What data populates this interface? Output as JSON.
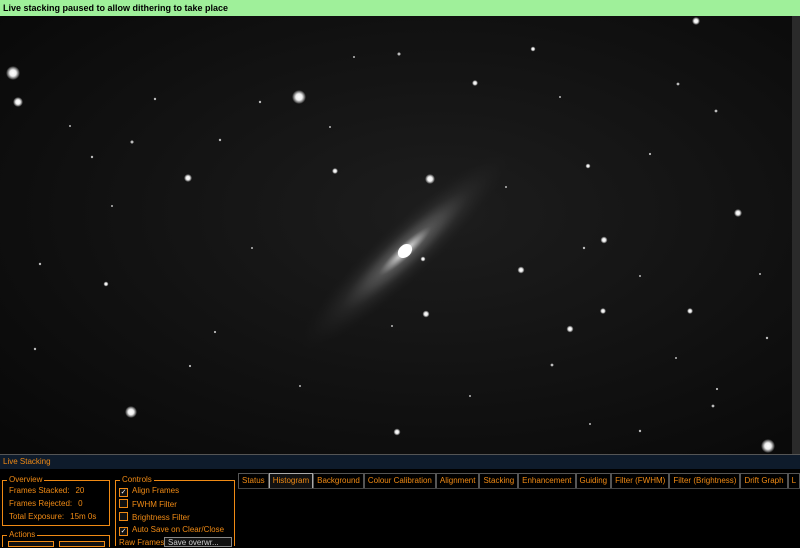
{
  "banner": {
    "text": "Live stacking paused to allow dithering to take place",
    "color": "#9ff09a"
  },
  "panel": {
    "title": "Live Stacking",
    "accent": "#f08a14",
    "overview": {
      "label": "Overview",
      "frames_stacked_label": "Frames Stacked:",
      "frames_stacked_value": "20",
      "frames_rejected_label": "Frames Rejected:",
      "frames_rejected_value": "0",
      "total_exposure_label": "Total Exposure:",
      "total_exposure_value": "15m 0s"
    },
    "actions": {
      "label": "Actions"
    },
    "controls": {
      "label": "Controls",
      "align_frames": "Align Frames",
      "fwhm_filter": "FWHM Filter",
      "brightness_filter": "Brightness Filter",
      "auto_save": "Auto Save on Clear/Close",
      "raw_frames_label": "Raw Frames",
      "raw_frames_value": "Save overwr..."
    },
    "tabs": [
      "Status",
      "Histogram",
      "Background",
      "Colour Calibration",
      "Alignment",
      "Stacking",
      "Enhancement",
      "Guiding",
      "Filter (FWHM)",
      "Filter (Brightness)",
      "Drift Graph",
      "L"
    ],
    "active_tab": "Histogram"
  }
}
